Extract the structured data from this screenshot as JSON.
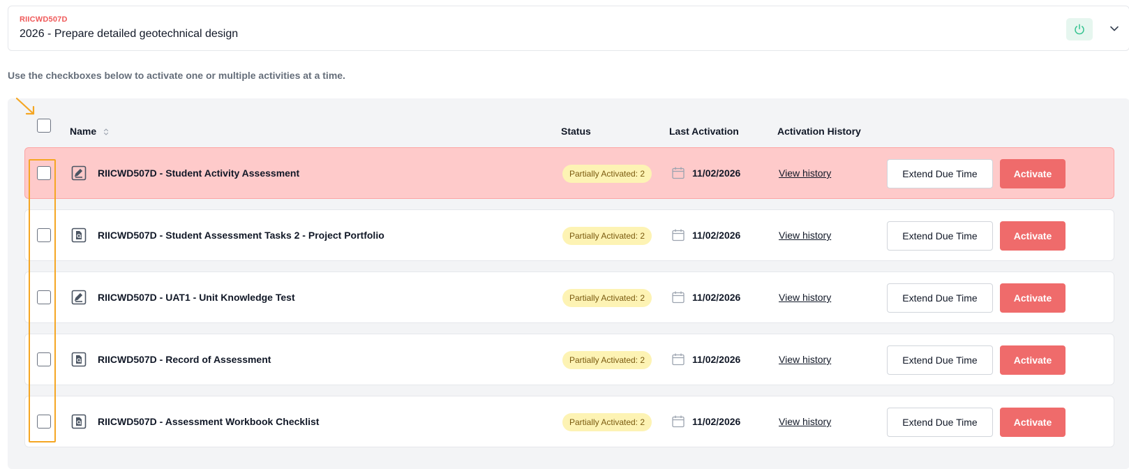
{
  "unit": {
    "code": "RIICWD507D",
    "title": "2026 - Prepare detailed geotechnical design"
  },
  "instructions": "Use the checkboxes below to activate one or multiple activities at a time.",
  "table": {
    "headers": {
      "name": "Name",
      "status": "Status",
      "last_activation": "Last Activation",
      "activation_history": "Activation History"
    },
    "rows": [
      {
        "icon": "edit-document-icon",
        "name": "RIICWD507D - Student Activity Assessment",
        "status": "Partially Activated: 2",
        "date": "11/02/2026",
        "history": "View history",
        "extend": "Extend Due Time",
        "activate": "Activate"
      },
      {
        "icon": "search-document-icon",
        "name": "RIICWD507D - Student Assessment Tasks 2 - Project Portfolio",
        "status": "Partially Activated: 2",
        "date": "11/02/2026",
        "history": "View history",
        "extend": "Extend Due Time",
        "activate": "Activate"
      },
      {
        "icon": "edit-document-icon",
        "name": "RIICWD507D - UAT1 - Unit Knowledge Test",
        "status": "Partially Activated: 2",
        "date": "11/02/2026",
        "history": "View history",
        "extend": "Extend Due Time",
        "activate": "Activate"
      },
      {
        "icon": "search-document-icon",
        "name": "RIICWD507D - Record of Assessment",
        "status": "Partially Activated: 2",
        "date": "11/02/2026",
        "history": "View history",
        "extend": "Extend Due Time",
        "activate": "Activate"
      },
      {
        "icon": "search-document-icon",
        "name": "RIICWD507D - Assessment Workbook Checklist",
        "status": "Partially Activated: 2",
        "date": "11/02/2026",
        "history": "View history",
        "extend": "Extend Due Time",
        "activate": "Activate"
      }
    ]
  },
  "colors": {
    "accent": "#ef6b6b",
    "highlight_row": "#fecaca",
    "status_badge": "#fdf3b4",
    "annotation": "#f5a623",
    "power_bg": "#e6f6ef",
    "power_icon": "#34c38f"
  }
}
